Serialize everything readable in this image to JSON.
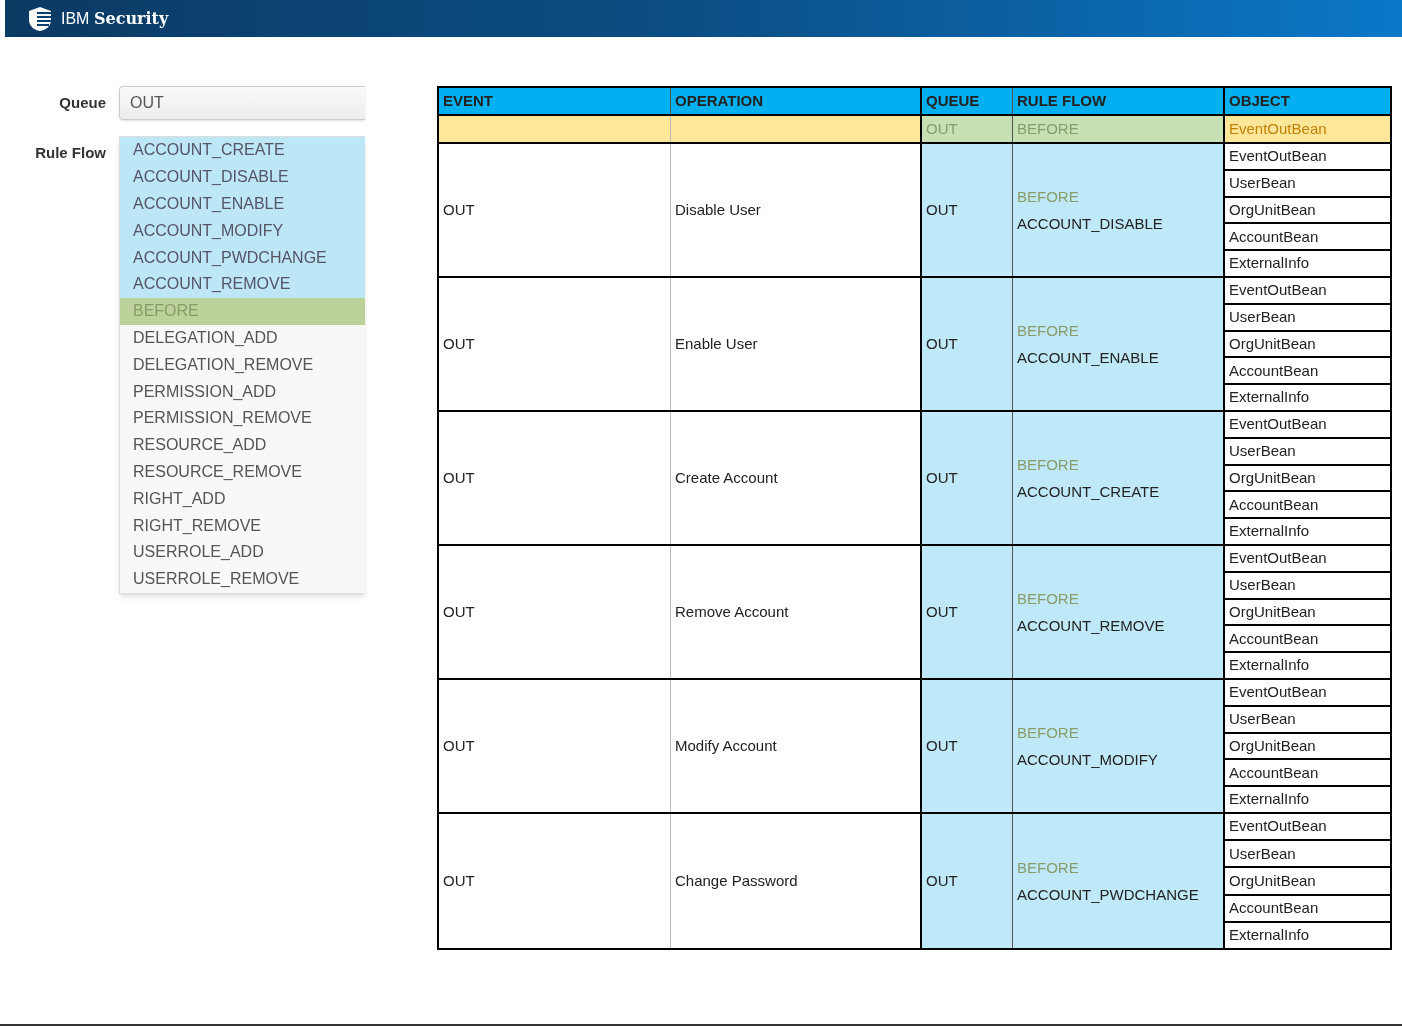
{
  "header": {
    "brand_light": "IBM",
    "brand_bold": "Security"
  },
  "form": {
    "queue": {
      "label": "Queue",
      "value": "OUT"
    },
    "rule_flow": {
      "label": "Rule Flow",
      "items": [
        {
          "label": "ACCOUNT_CREATE",
          "selected": true,
          "hovered": false
        },
        {
          "label": "ACCOUNT_DISABLE",
          "selected": true,
          "hovered": false
        },
        {
          "label": "ACCOUNT_ENABLE",
          "selected": true,
          "hovered": false
        },
        {
          "label": "ACCOUNT_MODIFY",
          "selected": true,
          "hovered": false
        },
        {
          "label": "ACCOUNT_PWDCHANGE",
          "selected": true,
          "hovered": false
        },
        {
          "label": "ACCOUNT_REMOVE",
          "selected": true,
          "hovered": false
        },
        {
          "label": "BEFORE",
          "selected": false,
          "hovered": true
        },
        {
          "label": "DELEGATION_ADD",
          "selected": false,
          "hovered": false
        },
        {
          "label": "DELEGATION_REMOVE",
          "selected": false,
          "hovered": false
        },
        {
          "label": "PERMISSION_ADD",
          "selected": false,
          "hovered": false
        },
        {
          "label": "PERMISSION_REMOVE",
          "selected": false,
          "hovered": false
        },
        {
          "label": "RESOURCE_ADD",
          "selected": false,
          "hovered": false
        },
        {
          "label": "RESOURCE_REMOVE",
          "selected": false,
          "hovered": false
        },
        {
          "label": "RIGHT_ADD",
          "selected": false,
          "hovered": false
        },
        {
          "label": "RIGHT_REMOVE",
          "selected": false,
          "hovered": false
        },
        {
          "label": "USERROLE_ADD",
          "selected": false,
          "hovered": false
        },
        {
          "label": "USERROLE_REMOVE",
          "selected": false,
          "hovered": false
        }
      ]
    }
  },
  "table": {
    "columns": [
      "EVENT",
      "OPERATION",
      "QUEUE",
      "RULE FLOW",
      "OBJECT"
    ],
    "highlight_row": {
      "queue": "OUT",
      "rule_flow": "BEFORE",
      "object": "EventOutBean"
    },
    "rows": [
      {
        "event": "OUT",
        "operation": "Disable User",
        "queue": "OUT",
        "rule_flow_stage": "BEFORE",
        "rule_flow": "ACCOUNT_DISABLE",
        "objects": [
          "EventOutBean",
          "UserBean",
          "OrgUnitBean",
          "AccountBean",
          "ExternalInfo"
        ]
      },
      {
        "event": "OUT",
        "operation": "Enable User",
        "queue": "OUT",
        "rule_flow_stage": "BEFORE",
        "rule_flow": "ACCOUNT_ENABLE",
        "objects": [
          "EventOutBean",
          "UserBean",
          "OrgUnitBean",
          "AccountBean",
          "ExternalInfo"
        ]
      },
      {
        "event": "OUT",
        "operation": "Create Account",
        "queue": "OUT",
        "rule_flow_stage": "BEFORE",
        "rule_flow": "ACCOUNT_CREATE",
        "objects": [
          "EventOutBean",
          "UserBean",
          "OrgUnitBean",
          "AccountBean",
          "ExternalInfo"
        ]
      },
      {
        "event": "OUT",
        "operation": "Remove Account",
        "queue": "OUT",
        "rule_flow_stage": "BEFORE",
        "rule_flow": "ACCOUNT_REMOVE",
        "objects": [
          "EventOutBean",
          "UserBean",
          "OrgUnitBean",
          "AccountBean",
          "ExternalInfo"
        ]
      },
      {
        "event": "OUT",
        "operation": "Modify Account",
        "queue": "OUT",
        "rule_flow_stage": "BEFORE",
        "rule_flow": "ACCOUNT_MODIFY",
        "objects": [
          "EventOutBean",
          "UserBean",
          "OrgUnitBean",
          "AccountBean",
          "ExternalInfo"
        ]
      },
      {
        "event": "OUT",
        "operation": "Change Password",
        "queue": "OUT",
        "rule_flow_stage": "BEFORE",
        "rule_flow": "ACCOUNT_PWDCHANGE",
        "objects": [
          "EventOutBean",
          "UserBean",
          "OrgUnitBean",
          "AccountBean",
          "ExternalInfo"
        ]
      }
    ]
  }
}
